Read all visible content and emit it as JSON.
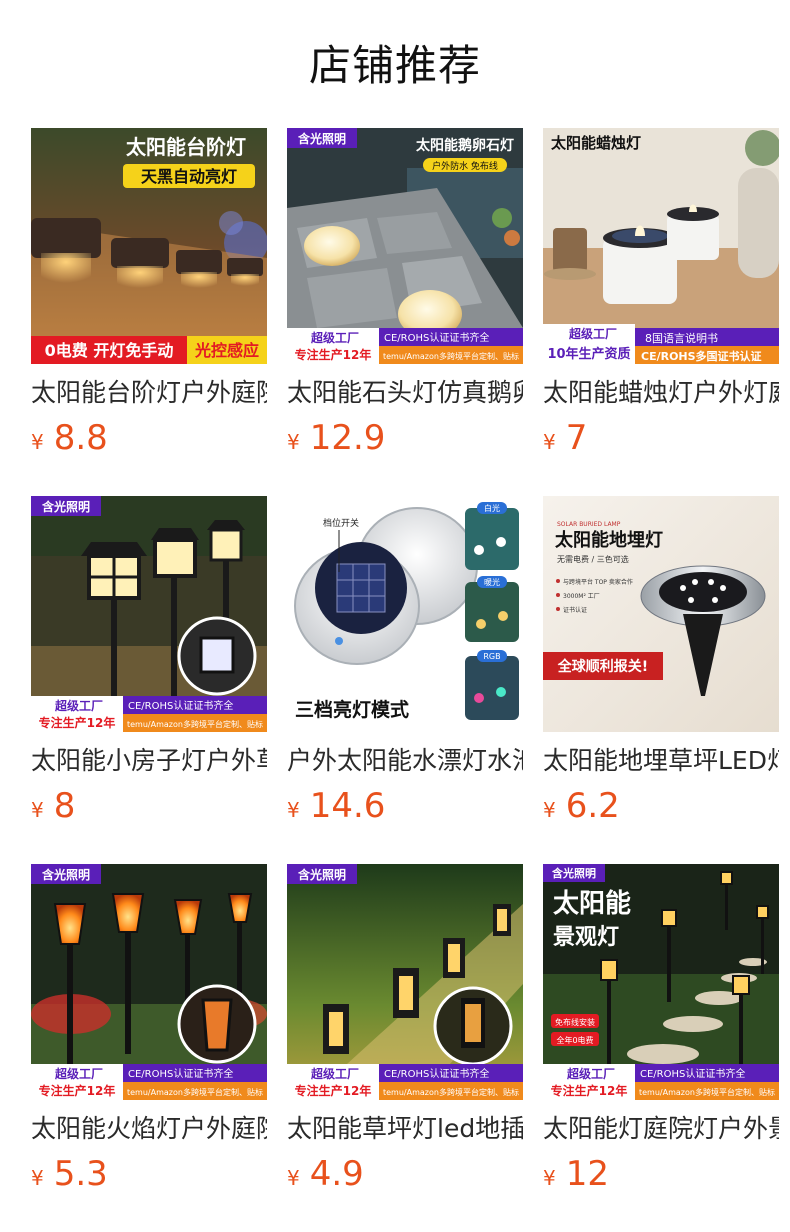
{
  "header": {
    "title": "店铺推荐"
  },
  "currency_symbol": "¥",
  "products": [
    {
      "name": "太阳能台阶灯户外庭院",
      "price": "8.8",
      "image_text": {
        "title": "太阳能台阶灯",
        "subtitle": "天黑自动亮灯",
        "bottom_left": "0电费 开灯免手动",
        "bottom_right": "光控感应"
      }
    },
    {
      "name": "太阳能石头灯仿真鹅卵石",
      "price": "12.9",
      "image_text": {
        "brand": "含光照明",
        "title": "太阳能鹅卵石灯",
        "subtitle": "户外防水 免布线",
        "badge_1": "超级工厂",
        "badge_2": "专注生产12年",
        "cert": "CE/ROHS认证证书齐全",
        "platforms": "temu/Amazon多跨境平台定制、贴标"
      }
    },
    {
      "name": "太阳能蜡烛灯户外灯庭院",
      "price": "7",
      "image_text": {
        "title": "太阳能蜡烛灯",
        "badge_1": "超级工厂",
        "badge_2": "10年生产资质",
        "lang": "8国语言说明书",
        "cert": "CE/ROHS多国证书认证"
      }
    },
    {
      "name": "太阳能小房子灯户外草坪",
      "price": "8",
      "image_text": {
        "brand": "含光照明",
        "badge_1": "超级工厂",
        "badge_2": "专注生产12年",
        "cert": "CE/ROHS认证证书齐全",
        "platforms": "temu/Amazon多跨境平台定制、贴标"
      }
    },
    {
      "name": "户外太阳能水漂灯水池",
      "price": "14.6",
      "image_text": {
        "switch_label": "档位开关",
        "mode_text": "三档亮灯模式",
        "mode_1": "白光",
        "mode_2": "暖光",
        "mode_3": "RGB"
      }
    },
    {
      "name": "太阳能地埋草坪LED灯户外",
      "price": "6.2",
      "image_text": {
        "small_header": "SOLAR BURIED LAMP",
        "title": "太阳能地埋灯",
        "subtitle": "无需电费 / 三色可选",
        "bullet_1": "与跨境平台 TOP 卖家合作",
        "bullet_2": "3000M² 工厂",
        "bullet_3": "证书认证",
        "banner": "全球顺利报关!"
      }
    },
    {
      "name": "太阳能火焰灯户外庭院",
      "price": "5.3",
      "image_text": {
        "brand": "含光照明",
        "badge_1": "超级工厂",
        "badge_2": "专注生产12年",
        "cert": "CE/ROHS认证证书齐全",
        "platforms": "temu/Amazon多跨境平台定制、贴标"
      }
    },
    {
      "name": "太阳能草坪灯led地插灯",
      "price": "4.9",
      "image_text": {
        "brand": "含光照明",
        "badge_1": "超级工厂",
        "badge_2": "专注生产12年",
        "cert": "CE/ROHS认证证书齐全",
        "platforms": "temu/Amazon多跨境平台定制、贴标"
      }
    },
    {
      "name": "太阳能灯庭院灯户外景观",
      "price": "12",
      "image_text": {
        "brand": "含光照明",
        "title_1": "太阳能",
        "title_2": "景观灯",
        "tag_1": "免布线安装",
        "tag_2": "全年0电费",
        "badge_1": "超级工厂",
        "badge_2": "专注生产12年",
        "cert": "CE/ROHS认证证书齐全",
        "platforms": "temu/Amazon多跨境平台定制、贴标"
      }
    }
  ],
  "colors": {
    "price": "#e8511c",
    "brand_purple": "#5a1fb8",
    "badge_orange": "#f08a1c",
    "badge_red": "#e31b23"
  }
}
